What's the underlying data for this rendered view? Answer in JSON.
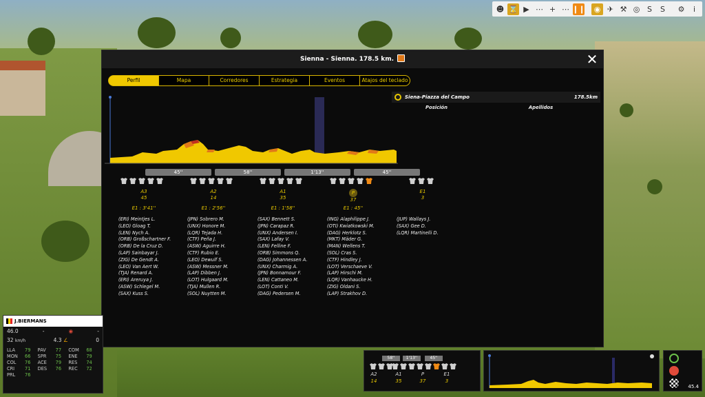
{
  "toolbar": [
    "person-icon",
    "hourglass-icon",
    "play-icon",
    "fast-forward-icon",
    "zoom-in-icon",
    "pause-icon",
    "eye-icon",
    "plane-icon",
    "wrench-icon",
    "target-icon",
    "s-icon",
    "sprint-icon",
    "settings-icon",
    "info-icon"
  ],
  "dialog": {
    "title": "Sienna - Sienna. 178.5 km.",
    "tabs": [
      "Perfil",
      "Mapa",
      "Corredores",
      "Estrategia",
      "Eventos",
      "Atajos del teclado"
    ]
  },
  "profile": {
    "sectors": [
      "45''",
      "58''",
      "1'13''",
      "45''"
    ],
    "groups": [
      {
        "label": "A3",
        "value": "45",
        "gap": "E1 : 3'41''",
        "riders": [
          "(ERI) Meintjes L.",
          "(LEO) Gloag T.",
          "(LEN) Nych A.",
          "(ORB) Großschartner F.",
          "(ORB) De la Cruz D.",
          "(LAP) Sainbayar J.",
          "(ZIG) De Gendt A.",
          "(LEO) Van Aert W.",
          "(TJA) Renard A.",
          "(ERI) Areruya J.",
          "(ASW) Schlegel M.",
          "(SAX) Kuss S."
        ]
      },
      {
        "label": "A2",
        "value": "14",
        "gap": "E1 : 2'56''",
        "riders": [
          "(JPN) Sobrero M.",
          "(UNX) Honore M.",
          "(LQR) Tejada H.",
          "(CTF) Peña J.",
          "(ASW) Aguirre H.",
          "(CTF) Rubio E.",
          "(LEO) Dewulf S.",
          "(ASW) Messner M.",
          "(LAP) Dibben J.",
          "(LOT) Hulgaard M.",
          "(TJA) Mullen R.",
          "(SOL) Nuytten M."
        ]
      },
      {
        "label": "A1",
        "value": "35",
        "gap": "E1 : 1'58''",
        "riders": [
          "(SAX) Bennett S.",
          "(JPN) Carapaz R.",
          "(UNX) Andersen I.",
          "(SAX) Lafay V.",
          "(LEN) Felline F.",
          "(ORB) Simmons Q.",
          "(DAG) Johannessen A.",
          "(UNX) Charmig A.",
          "(JPN) Bonnamour F.",
          "(LEN) Cattaneo M.",
          "(LOT) Conti V.",
          "(DAG) Pedersen M."
        ]
      },
      {
        "label": "P",
        "value": "37",
        "gap": "E1 : 45''",
        "riders": [
          "(ING) Alaphilippe J.",
          "(OTI) Kwiatkowski M.",
          "(DAG) Herklotz S.",
          "(MKT) Mäder G.",
          "(MAN) Wellens T.",
          "(SOL) Cras S.",
          "(CTF) Hindley J.",
          "(LOT) Verschaeve V.",
          "(LAP) Hirschi M.",
          "(LQR) Vanhaucke H.",
          "(ZIG) Oldani S.",
          "(LAP) Strakhov D."
        ]
      },
      {
        "label": "E1",
        "value": "3",
        "gap": "",
        "riders": [
          "(JUP) Wallays J.",
          "(SAX) Gee D.",
          "(LQR) Martinelli D."
        ]
      }
    ]
  },
  "panel": {
    "finish": "Siena-Piazza del Campo",
    "distance": "178.5km",
    "col_position": "Posición",
    "col_name": "Apellidos"
  },
  "rider": {
    "name": "J.BIERMANS",
    "speed": "46.0",
    "speed_sub": "32",
    "speed_unit": "km/h",
    "dash1": "-",
    "gradient": "4.3",
    "dash2": "-",
    "zero": "0",
    "stats": [
      {
        "k": "LLA",
        "v": "79"
      },
      {
        "k": "PAV",
        "v": "77"
      },
      {
        "k": "COM",
        "v": "68"
      },
      {
        "k": "MON",
        "v": "66"
      },
      {
        "k": "SPR",
        "v": "75"
      },
      {
        "k": "ENE",
        "v": "79"
      },
      {
        "k": "COL",
        "v": "76"
      },
      {
        "k": "ACE",
        "v": "79"
      },
      {
        "k": "RES",
        "v": "74"
      },
      {
        "k": "CRI",
        "v": "71"
      },
      {
        "k": "DES",
        "v": "76"
      },
      {
        "k": "REC",
        "v": "72"
      },
      {
        "k": "PRL",
        "v": "76"
      }
    ]
  },
  "mini": {
    "sectors": [
      "58''",
      "1'13''",
      "45''"
    ],
    "groups": [
      {
        "label": "A2",
        "value": "14"
      },
      {
        "label": "A1",
        "value": "35"
      },
      {
        "label": "P",
        "value": "37"
      },
      {
        "label": "E1",
        "value": "3"
      }
    ],
    "side_value": "45.4"
  }
}
